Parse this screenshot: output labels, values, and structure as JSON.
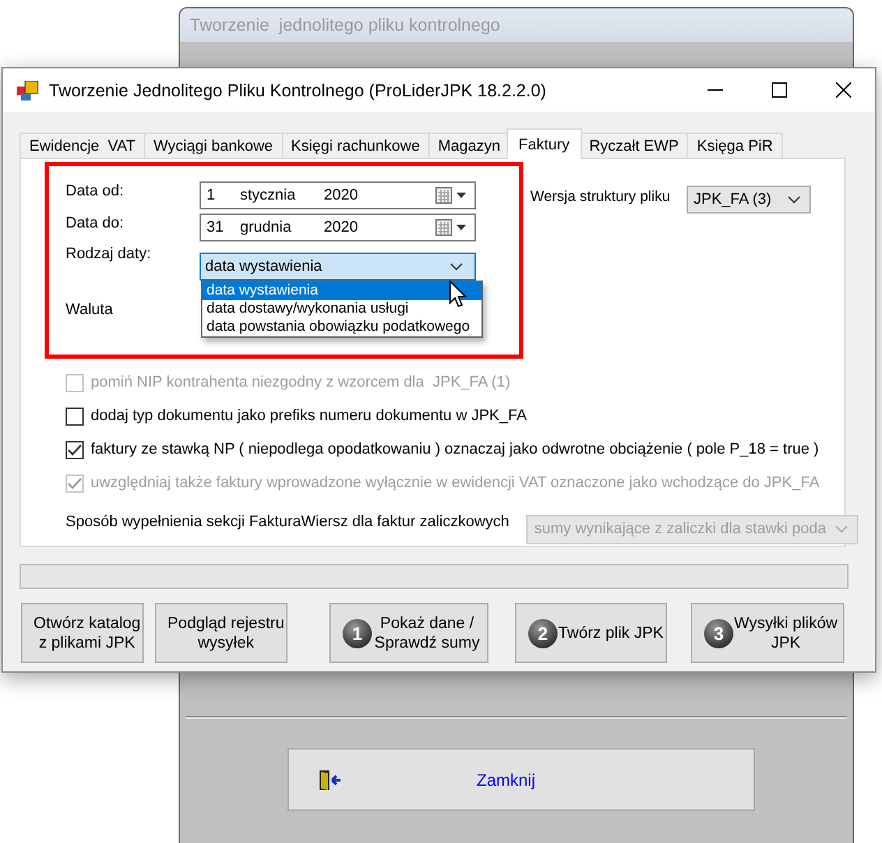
{
  "background_window": {
    "title": "Tworzenie  jednolitego pliku kontrolnego",
    "close_button": "Zamknij"
  },
  "window": {
    "title": "Tworzenie Jednolitego Pliku Kontrolnego (ProLiderJPK 18.2.2.0)"
  },
  "tabs": [
    {
      "label": "Ewidencje  VAT",
      "selected": false
    },
    {
      "label": "Wyciągi bankowe",
      "selected": false
    },
    {
      "label": "Księgi rachunkowe",
      "selected": false
    },
    {
      "label": "Magazyn",
      "selected": false
    },
    {
      "label": "Faktury",
      "selected": true
    },
    {
      "label": "Ryczałt EWP",
      "selected": false
    },
    {
      "label": "Księga PiR",
      "selected": false
    }
  ],
  "dates": [
    {
      "label": "Data od:",
      "day": "1",
      "month": "stycznia",
      "year": "2020"
    },
    {
      "label": "Data do:",
      "day": "31",
      "month": "grudnia",
      "year": "2020"
    }
  ],
  "date_type": {
    "label": "Rodzaj daty:",
    "value": "data wystawienia",
    "expanded": true,
    "options": [
      {
        "label": "data wystawienia",
        "selected": true
      },
      {
        "label": "data dostawy/wykonania usługi",
        "selected": false
      },
      {
        "label": "data powstania obowiązku podatkowego",
        "selected": false
      }
    ]
  },
  "currency": {
    "label": "Waluta"
  },
  "structure_version": {
    "label": "Wersja struktury pliku",
    "value": "JPK_FA (3)"
  },
  "options": [
    {
      "label": "pomiń NIP kontrahenta niezgodny z wzorcem dla  JPK_FA (1)",
      "checked": false,
      "disabled": true
    },
    {
      "label": "dodaj typ dokumentu jako prefiks numeru dokumentu w JPK_FA",
      "checked": false,
      "disabled": false
    },
    {
      "label": "faktury ze stawką NP ( niepodlega opodatkowaniu ) oznaczaj jako odwrotne obciążenie ( pole P_18 = true )",
      "checked": true,
      "disabled": false
    },
    {
      "label": "uwzględniaj także faktury wprowadzone wyłącznie w ewidencji VAT oznaczone jako wchodzące do JPK_FA",
      "checked": true,
      "disabled": true
    }
  ],
  "advance_invoice": {
    "label": "Sposób wypełnienia sekcji FakturaWiersz dla faktur zaliczkowych",
    "value": "sumy wynikające z zaliczki dla stawki poda",
    "disabled": true
  },
  "progress": {
    "level": 0
  },
  "buttons": [
    {
      "kind": "plain",
      "label": "Otwórz katalog\nz plikami JPK"
    },
    {
      "kind": "plain",
      "label": "Podgląd rejestru\nwysyłek"
    },
    {
      "kind": "step",
      "step": "1",
      "label": "Pokaż dane /\nSprawdź sumy"
    },
    {
      "kind": "step",
      "step": "2",
      "label": "Twórz plik JPK"
    },
    {
      "kind": "step",
      "step": "3",
      "label": "Wysyłki plików\nJPK"
    }
  ]
}
